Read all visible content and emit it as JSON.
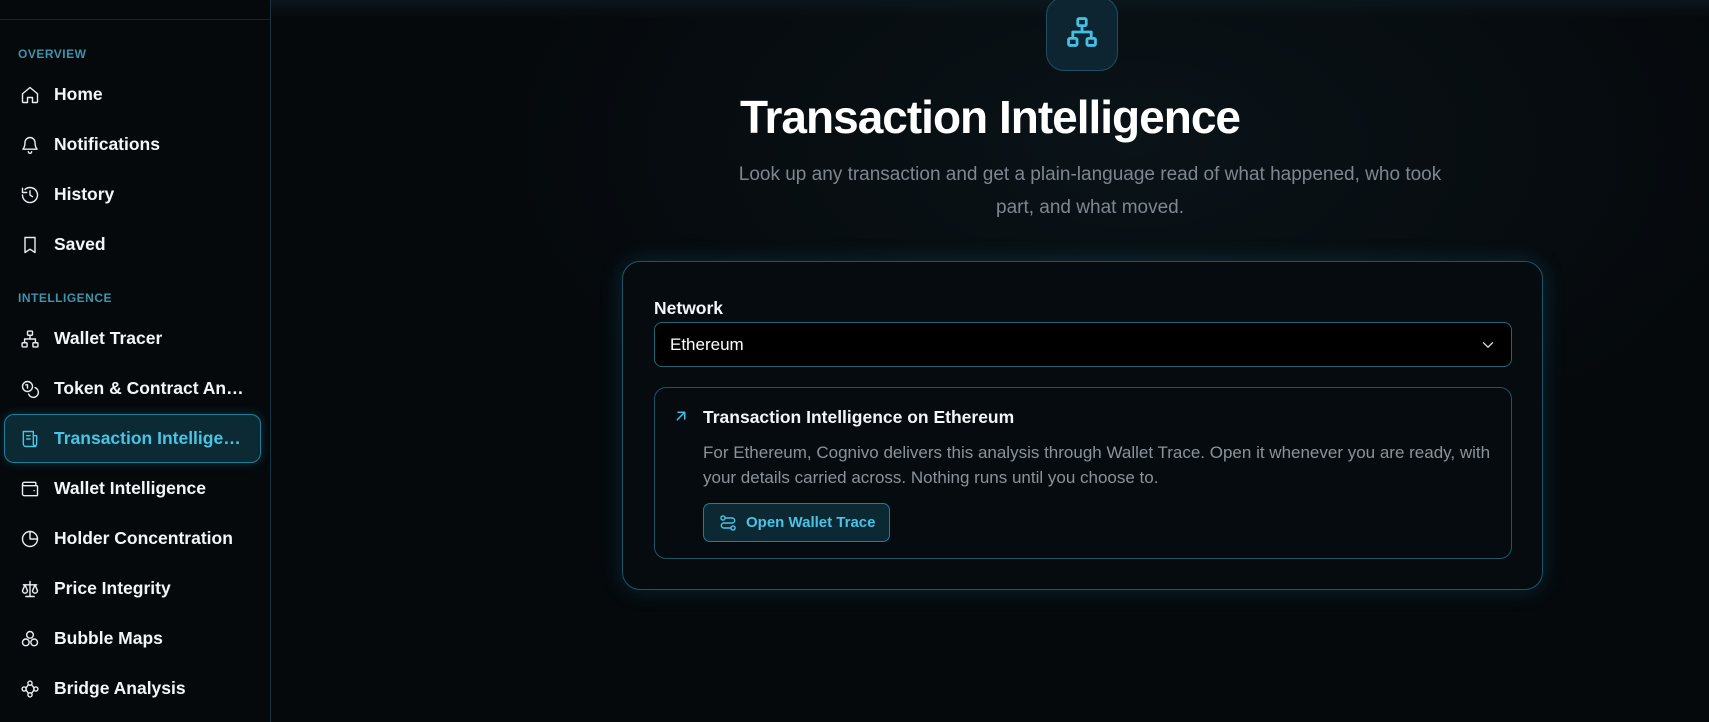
{
  "sidebar": {
    "sections": [
      {
        "label": "OVERVIEW"
      },
      {
        "label": "INTELLIGENCE"
      }
    ],
    "items": [
      {
        "label": "Home",
        "icon": "home-icon"
      },
      {
        "label": "Notifications",
        "icon": "bell-icon"
      },
      {
        "label": "History",
        "icon": "history-icon"
      },
      {
        "label": "Saved",
        "icon": "bookmark-icon"
      },
      {
        "label": "Wallet Tracer",
        "icon": "network-icon"
      },
      {
        "label": "Token & Contract Analysis",
        "icon": "coins-icon"
      },
      {
        "label": "Transaction Intelligence",
        "icon": "receipt-icon",
        "active": true
      },
      {
        "label": "Wallet Intelligence",
        "icon": "wallet-icon"
      },
      {
        "label": "Holder Concentration",
        "icon": "pie-chart-icon"
      },
      {
        "label": "Price Integrity",
        "icon": "scale-icon"
      },
      {
        "label": "Bubble Maps",
        "icon": "bubbles-icon"
      },
      {
        "label": "Bridge Analysis",
        "icon": "bridge-icon"
      }
    ]
  },
  "main": {
    "hero_icon": "network-icon",
    "title": "Transaction Intelligence",
    "subtitle": "Look up any transaction and get a plain-language read of what happened, who took part, and what moved.",
    "card": {
      "network_label": "Network",
      "network_value": "Ethereum",
      "notice": {
        "icon": "arrow-up-right-icon",
        "title": "Transaction Intelligence on Ethereum",
        "body": "For Ethereum, Cognivo delivers this analysis through Wallet Trace. Open it whenever you are ready, with your details carried across. Nothing runs until you choose to.",
        "button_label": "Open Wallet Trace",
        "button_icon": "route-icon"
      }
    }
  },
  "colors": {
    "accent": "#49c3e6",
    "background": "#05090c",
    "border": "#1e5566"
  }
}
